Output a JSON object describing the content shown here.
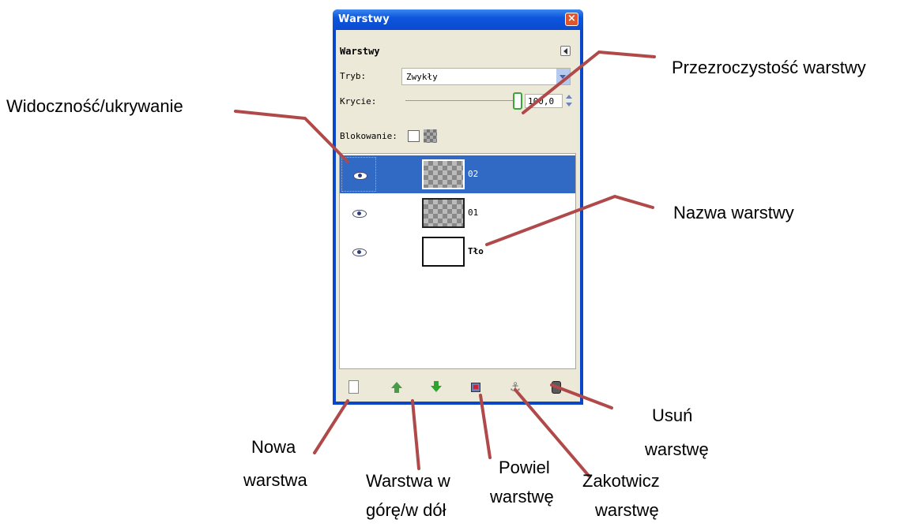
{
  "window": {
    "title": "Warstwy",
    "close_glyph": "×"
  },
  "panel": {
    "header": "Warstwy",
    "mode_label": "Tryb:",
    "mode_value": "Zwykły",
    "opacity_label": "Krycie:",
    "opacity_value": "100,0",
    "opacity_percent": 100,
    "lock_label": "Blokowanie:"
  },
  "layers": [
    {
      "name": "02",
      "visible": true,
      "selected": true,
      "thumb": "transparent"
    },
    {
      "name": "01",
      "visible": true,
      "selected": false,
      "thumb": "transparent"
    },
    {
      "name": "Tło",
      "visible": true,
      "selected": false,
      "thumb": "white"
    }
  ],
  "toolbar": {
    "icons": [
      "new-layer-icon",
      "raise-layer-icon",
      "lower-layer-icon",
      "duplicate-layer-icon",
      "anchor-layer-icon",
      "delete-layer-icon"
    ],
    "anchor_glyph": "⚓"
  },
  "annotations": {
    "visibility": "Widoczność/ukrywanie",
    "opacity": "Przezroczystość warstwy",
    "layer_name": "Nazwa warstwy",
    "new_layer_1": "Nowa",
    "new_layer_2": "warstwa",
    "move_1": "Warstwa w",
    "move_2": "górę/w dół",
    "duplicate_1": "Powiel",
    "duplicate_2": "warstwę",
    "anchor_1": "Zakotwicz",
    "anchor_2": "warstwę",
    "delete_1": "Usuń",
    "delete_2": "warstwę"
  },
  "colors": {
    "titlebar": "#0d56dc",
    "selection": "#316ac5",
    "leader": "#b04a4a"
  }
}
